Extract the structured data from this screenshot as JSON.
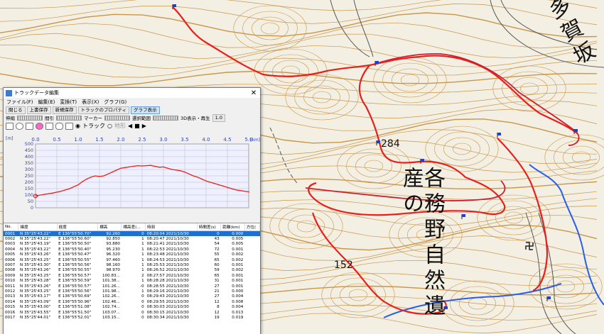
{
  "map": {
    "labels": {
      "pass_name": "多賀坂",
      "reserve_name": "各務野自然遺産の",
      "elev_284": "284",
      "elev_152": "152"
    },
    "colors": {
      "contour": "#c9964a",
      "track": "#e8201c",
      "route": "#cf1f2e",
      "water": "#2a5ee8",
      "background": "#f3efe3"
    }
  },
  "window": {
    "title": "トラックデータ編集",
    "menu": [
      "ファイル(F)",
      "編集(E)",
      "変換(T)",
      "表示(X)",
      "グラフ(G)"
    ],
    "toolbar": [
      "閉じる",
      "上書保存",
      "新規保存",
      "トラックのプロパティ",
      "グラフ表示"
    ],
    "sliders": {
      "thin": "伸縮",
      "decimate": "間引",
      "marker": "マーカー",
      "select_range": "選択範囲",
      "display_3d": "3D表示・再生",
      "speed": "1.0"
    },
    "radio": {
      "track": "トラック",
      "terrain": "地形"
    }
  },
  "chart_data": {
    "type": "line",
    "xlabel": "",
    "ylabel": "[m]",
    "x_unit_label": "[km]",
    "xlim": [
      0,
      5.0
    ],
    "ylim": [
      0,
      500
    ],
    "x_ticks": [
      "0.0",
      "0.5",
      "1.0",
      "1.5",
      "2.0",
      "2.5",
      "3.0",
      "3.5",
      "4.0",
      "4.5",
      "5.0"
    ],
    "y_ticks": [
      "500",
      "450",
      "400",
      "350",
      "300",
      "250",
      "200",
      "150",
      "100",
      "50",
      "0"
    ],
    "series": [
      {
        "color": "#e8201c",
        "x": [
          0,
          0.2,
          0.4,
          0.6,
          0.8,
          1.0,
          1.1,
          1.2,
          1.3,
          1.4,
          1.5,
          1.6,
          1.7,
          1.8,
          1.9,
          2.0,
          2.1,
          2.2,
          2.3,
          2.4,
          2.5,
          2.6,
          2.7,
          2.8,
          2.9,
          3.0,
          3.1,
          3.2,
          3.3,
          3.4,
          3.5,
          3.6,
          3.7,
          3.8,
          3.9,
          4.0,
          4.1,
          4.2,
          4.3,
          4.4,
          4.5,
          4.6,
          4.7,
          4.8,
          4.9,
          5.0,
          5.1
        ],
        "y": [
          92,
          105,
          115,
          130,
          150,
          180,
          205,
          225,
          240,
          250,
          245,
          250,
          265,
          280,
          295,
          310,
          315,
          320,
          325,
          330,
          328,
          330,
          332,
          325,
          318,
          320,
          310,
          300,
          295,
          290,
          280,
          265,
          250,
          240,
          225,
          210,
          200,
          190,
          180,
          170,
          160,
          150,
          140,
          135,
          130,
          125,
          122
        ]
      }
    ]
  },
  "table": {
    "columns": [
      "No.",
      "緯度",
      "経度",
      "標高",
      "標高差(...",
      "時刻",
      "時間差(s)",
      "距離(km)",
      "方位("
    ],
    "rows": [
      [
        "0001",
        "N 35°25'43.22\"",
        "E 136°55'50.70\"",
        "92.260",
        "0",
        "08:20:04  2021/10/30",
        "0",
        "0.000",
        ""
      ],
      [
        "0002",
        "N 35°25'43.22\"",
        "E 136°55'50.60\"",
        "92.850",
        "1",
        "08:20:47  2021/10/30",
        "43",
        "0.005",
        ""
      ],
      [
        "0003",
        "N 35°25'43.19\"",
        "E 136°55'50.50\"",
        "93.880",
        "1",
        "08:21:41  2021/10/30",
        "54",
        "0.005",
        ""
      ],
      [
        "0004",
        "N 35°25'43.22\"",
        "E 136°55'50.40\"",
        "95.230",
        "1",
        "08:22:53  2021/10/30",
        "72",
        "0.001",
        ""
      ],
      [
        "0005",
        "N 35°25'43.26\"",
        "E 136°55'50.47\"",
        "96.320",
        "1",
        "08:23:48  2021/10/30",
        "55",
        "0.002",
        ""
      ],
      [
        "0006",
        "N 35°25'43.25\"",
        "E 136°55'50.55\"",
        "97.460",
        "1",
        "08:24:53  2021/10/30",
        "65",
        "0.002",
        ""
      ],
      [
        "0007",
        "N 35°25'43.30\"",
        "E 136°55'50.56\"",
        "98.160",
        "1",
        "08:25:53  2021/10/30",
        "60",
        "0.001",
        ""
      ],
      [
        "0008",
        "N 35°25'43.26\"",
        "E 136°55'50.55\"",
        "98.970",
        "1",
        "08:26:52  2021/10/30",
        "59",
        "0.002",
        ""
      ],
      [
        "0009",
        "N 35°25'43.25\"",
        "E 136°55'50.57\"",
        "100.83...",
        "2",
        "08:27:57  2021/10/30",
        "65",
        "0.001",
        ""
      ],
      [
        "0010",
        "N 35°25'43.28\"",
        "E 136°55'50.59\"",
        "101.38...",
        "1",
        "08:28:28  2021/10/30",
        "31",
        "0.001",
        ""
      ],
      [
        "0011",
        "N 35°25'43.26\"",
        "E 136°55'50.57\"",
        "101.26...",
        "-0",
        "08:28:55  2021/10/30",
        "27",
        "0.001",
        ""
      ],
      [
        "0012",
        "N 35°25'43.25\"",
        "E 136°55'50.56\"",
        "101.98...",
        "1",
        "08:29:16  2021/10/30",
        "21",
        "0.000",
        ""
      ],
      [
        "0013",
        "N 35°25'43.17\"",
        "E 136°55'50.69\"",
        "102.26...",
        "0",
        "08:29:43  2021/10/30",
        "27",
        "0.004",
        ""
      ],
      [
        "0014",
        "N 35°25'43.09\"",
        "E 136°55'50.96\"",
        "102.46...",
        "0",
        "08:29:55  2021/10/30",
        "12",
        "0.008",
        ""
      ],
      [
        "0015",
        "N 35°25'43.00\"",
        "E 136°55'51.08\"",
        "102.74...",
        "0",
        "08:30:03  2021/10/30",
        "8",
        "0.004",
        ""
      ],
      [
        "0016",
        "N 35°25'43.55\"",
        "E 136°55'51.50\"",
        "103.07...",
        "0",
        "08:30:15  2021/10/30",
        "12",
        "0.013",
        ""
      ],
      [
        "0017",
        "N 35°25'44.01\"",
        "E 136°55'52.01\"",
        "103.15...",
        "0",
        "08:30:34  2021/10/30",
        "19",
        "0.019",
        ""
      ]
    ]
  }
}
